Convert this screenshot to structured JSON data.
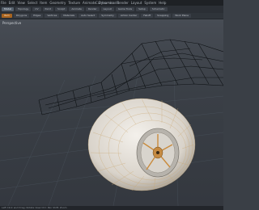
{
  "menubar": {
    "items": [
      "File",
      "Edit",
      "View",
      "Select",
      "Item",
      "Geometry",
      "Texture",
      "Animate",
      "Dynamics",
      "Render",
      "Layout",
      "System",
      "Help"
    ],
    "title": "Car.lxo - modo"
  },
  "layout_tabs": [
    "Model",
    "Topology",
    "UV",
    "Paint",
    "Sculpt",
    "Animate",
    "Render",
    "Layout",
    "Game Tools",
    "Setup",
    "Schematic"
  ],
  "active_tab_index": 0,
  "tool_buttons": [
    "Item",
    "Polygons",
    "Edges",
    "Vertices",
    "Materials",
    "Auto Select",
    "Symmetry",
    "Action Center",
    "Falloff",
    "Snapping",
    "Work Plane"
  ],
  "viewport": {
    "label": "Perspective"
  },
  "statusbar": {
    "text": "Left Click and Drag: Rotate View   Ctrl: Pan   Shift: Zoom"
  },
  "colors": {
    "accent": "#a8641f",
    "viewport_bg": "#3f444b",
    "wireframe": "#111418",
    "wheel_surface": "#e3dfd8",
    "wheel_wire": "#d3a15b"
  }
}
